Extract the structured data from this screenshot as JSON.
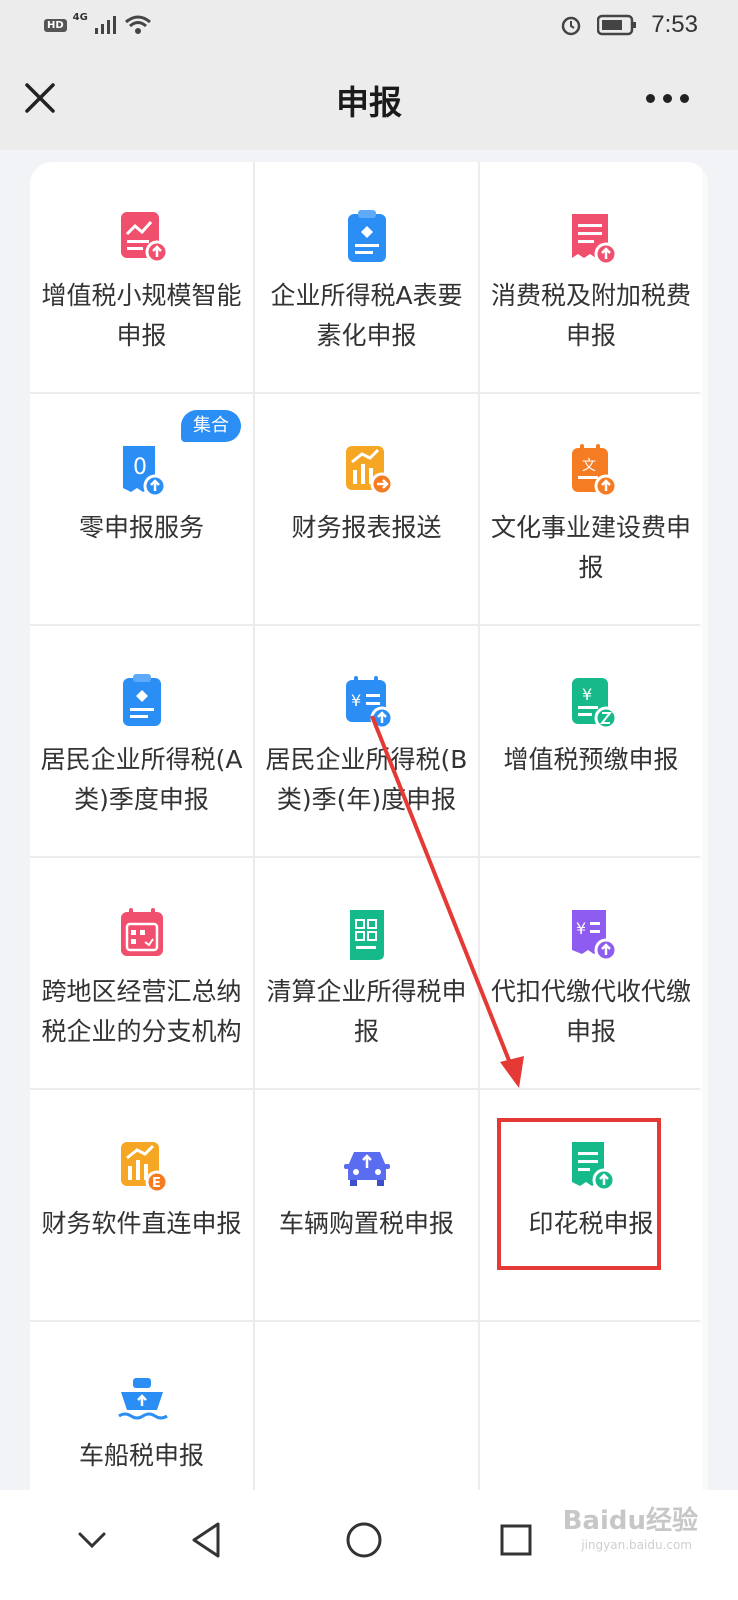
{
  "status_bar": {
    "hd_label": "HD",
    "network_label": "4G",
    "time": "7:53",
    "icons": [
      "signal-icon",
      "wifi-icon",
      "alarm-icon",
      "battery-icon"
    ]
  },
  "header": {
    "title": "申报",
    "close_icon": "close-icon",
    "more_icon": "more-icon"
  },
  "grid": {
    "items": [
      {
        "label": "增值税小规模智能申报",
        "icon": "report-icon",
        "color": "#f0506e"
      },
      {
        "label": "企业所得税A表要素化申报",
        "icon": "clipboard-icon",
        "color": "#2b8ef4"
      },
      {
        "label": "消费税及附加税费申报",
        "icon": "receipt-icon",
        "color": "#f0506e"
      },
      {
        "label": "零申报服务",
        "icon": "zero-report-icon",
        "color": "#2b8ef4",
        "badge": "集合"
      },
      {
        "label": "财务报表报送",
        "icon": "chart-send-icon",
        "color": "#f5a623"
      },
      {
        "label": "文化事业建设费申报",
        "icon": "culture-fee-icon",
        "color": "#f57c23"
      },
      {
        "label": "居民企业所得税(A类)季度申报",
        "icon": "clipboard-icon",
        "color": "#2b8ef4"
      },
      {
        "label": "居民企业所得税(B类)季(年)度申报",
        "icon": "calendar-yen-icon",
        "color": "#2b8ef4"
      },
      {
        "label": "增值税预缴申报",
        "icon": "yen-receipt-icon",
        "color": "#16b98a"
      },
      {
        "label": "跨地区经营汇总纳税企业的分支机构",
        "icon": "calendar-icon",
        "color": "#f0506e"
      },
      {
        "label": "清算企业所得税申报",
        "icon": "calculator-icon",
        "color": "#16b98a"
      },
      {
        "label": "代扣代缴代收代缴申报",
        "icon": "yen-upload-icon",
        "color": "#8e5cf0"
      },
      {
        "label": "财务软件直连申报",
        "icon": "software-e-icon",
        "color": "#f5a623"
      },
      {
        "label": "车辆购置税申报",
        "icon": "car-icon",
        "color": "#5a6cf0"
      },
      {
        "label": "印花税申报",
        "icon": "stamp-receipt-icon",
        "color": "#16b98a"
      },
      {
        "label": "车船税申报",
        "icon": "ship-icon",
        "color": "#2b8ef4"
      }
    ]
  },
  "annotation": {
    "highlight_color": "#e53935"
  },
  "nav_bar": {
    "icons": [
      "collapse-icon",
      "back-icon",
      "home-icon",
      "recents-icon"
    ]
  },
  "watermark": {
    "text": "Baidu经验",
    "sub": "jingyan.baidu.com"
  }
}
